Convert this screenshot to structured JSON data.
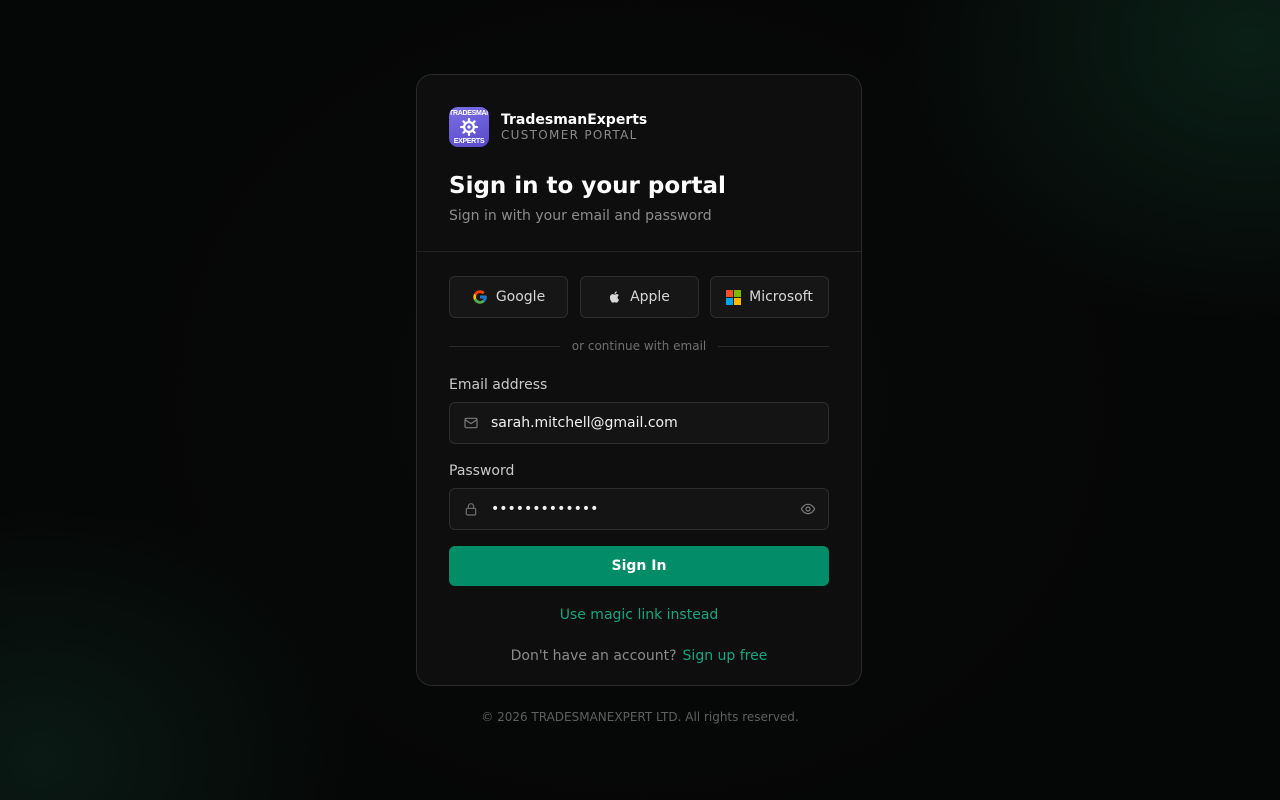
{
  "brand": {
    "logo_text_top": "TRADESMAN",
    "logo_text_bottom": "EXPERTS",
    "name": "TradesmanExperts",
    "subtitle": "CUSTOMER PORTAL"
  },
  "header": {
    "title": "Sign in to your portal",
    "subtitle": "Sign in with your email and password"
  },
  "oauth": {
    "google_label": "Google",
    "apple_label": "Apple",
    "microsoft_label": "Microsoft"
  },
  "divider_text": "or continue with email",
  "email": {
    "label": "Email address",
    "value": "sarah.mitchell@gmail.com"
  },
  "password": {
    "label": "Password",
    "value": "•••••••••••••"
  },
  "signin_label": "Sign In",
  "magic_link_label": "Use magic link instead",
  "signup": {
    "prompt": "Don't have an account?",
    "link_label": "Sign up free"
  },
  "footer": "© 2026 TRADESMANEXPERT LTD. All rights reserved.",
  "colors": {
    "accent": "#028c68",
    "link": "#17a57f",
    "card_bg": "#0e0e0e",
    "logo_bg": "#6a5ad8"
  },
  "icons": {
    "logo": "gear-icon",
    "google": "google-icon",
    "apple": "apple-icon",
    "microsoft": "microsoft-icon",
    "email": "mail-icon",
    "password": "lock-icon",
    "toggle": "eye-icon"
  }
}
